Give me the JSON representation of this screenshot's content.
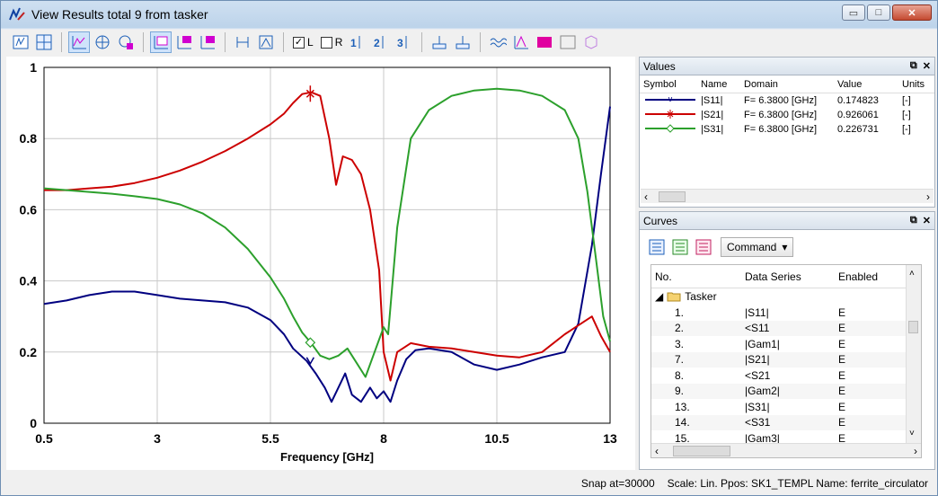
{
  "window": {
    "title": "View Results total 9 from tasker",
    "controls": {
      "minimize": "▭",
      "maximize": "□",
      "close": "✕"
    }
  },
  "toolbar": {
    "checkbox_l": {
      "label": "L",
      "checked": true
    },
    "checkbox_r": {
      "label": "R",
      "checked": false
    }
  },
  "chart_data": {
    "type": "line",
    "xlabel": "Frequency [GHz]",
    "ylabel": "",
    "xlim": [
      0.5,
      13
    ],
    "ylim": [
      0,
      1
    ],
    "xticks": [
      "0.5",
      "3",
      "5.5",
      "8",
      "10.5",
      "13"
    ],
    "yticks": [
      "0",
      "0.2",
      "0.4",
      "0.6",
      "0.8",
      "1"
    ],
    "grid": true,
    "series": [
      {
        "name": "|S11|",
        "color": "#000080",
        "x": [
          0.5,
          1.0,
          1.5,
          2.0,
          2.5,
          3.0,
          3.5,
          4.0,
          4.5,
          5.0,
          5.5,
          5.8,
          6.0,
          6.3,
          6.5,
          6.7,
          6.85,
          7.0,
          7.15,
          7.3,
          7.5,
          7.7,
          7.85,
          8.0,
          8.15,
          8.3,
          8.5,
          8.7,
          9.0,
          9.5,
          10.0,
          10.5,
          11.0,
          11.5,
          12.0,
          12.3,
          12.6,
          12.8,
          13.0
        ],
        "y": [
          0.335,
          0.345,
          0.36,
          0.37,
          0.37,
          0.36,
          0.35,
          0.345,
          0.34,
          0.325,
          0.29,
          0.25,
          0.21,
          0.175,
          0.14,
          0.1,
          0.06,
          0.1,
          0.14,
          0.08,
          0.06,
          0.1,
          0.07,
          0.09,
          0.06,
          0.12,
          0.18,
          0.205,
          0.21,
          0.2,
          0.165,
          0.15,
          0.165,
          0.185,
          0.2,
          0.28,
          0.5,
          0.7,
          0.89
        ]
      },
      {
        "name": "|S21|",
        "color": "#cc0000",
        "x": [
          0.5,
          1.0,
          1.5,
          2.0,
          2.5,
          3.0,
          3.5,
          4.0,
          4.5,
          5.0,
          5.5,
          5.8,
          6.0,
          6.2,
          6.4,
          6.6,
          6.8,
          6.95,
          7.1,
          7.3,
          7.5,
          7.7,
          7.9,
          8.0,
          8.15,
          8.3,
          8.6,
          9.0,
          9.5,
          10.0,
          10.5,
          11.0,
          11.5,
          12.0,
          12.3,
          12.6,
          12.8,
          13.0
        ],
        "y": [
          0.655,
          0.655,
          0.66,
          0.665,
          0.675,
          0.69,
          0.71,
          0.735,
          0.765,
          0.8,
          0.84,
          0.87,
          0.9,
          0.925,
          0.93,
          0.92,
          0.8,
          0.67,
          0.75,
          0.74,
          0.7,
          0.6,
          0.43,
          0.2,
          0.12,
          0.2,
          0.225,
          0.215,
          0.21,
          0.2,
          0.19,
          0.185,
          0.2,
          0.25,
          0.275,
          0.3,
          0.245,
          0.2
        ]
      },
      {
        "name": "|S31|",
        "color": "#2ca02c",
        "x": [
          0.5,
          1.0,
          1.5,
          2.0,
          2.5,
          3.0,
          3.5,
          4.0,
          4.5,
          5.0,
          5.5,
          5.8,
          6.0,
          6.2,
          6.4,
          6.6,
          6.8,
          7.0,
          7.2,
          7.4,
          7.6,
          7.8,
          8.0,
          8.1,
          8.3,
          8.6,
          9.0,
          9.5,
          10.0,
          10.5,
          11.0,
          11.5,
          12.0,
          12.3,
          12.5,
          12.7,
          12.85,
          13.0
        ],
        "y": [
          0.66,
          0.655,
          0.65,
          0.645,
          0.638,
          0.63,
          0.615,
          0.59,
          0.55,
          0.49,
          0.41,
          0.35,
          0.3,
          0.255,
          0.225,
          0.19,
          0.18,
          0.19,
          0.21,
          0.17,
          0.13,
          0.2,
          0.27,
          0.25,
          0.55,
          0.8,
          0.88,
          0.92,
          0.935,
          0.94,
          0.935,
          0.92,
          0.88,
          0.8,
          0.65,
          0.45,
          0.3,
          0.23
        ]
      }
    ]
  },
  "values_panel": {
    "title": "Values",
    "columns": [
      "Symbol",
      "Name",
      "Domain",
      "Value",
      "Units"
    ],
    "rows": [
      {
        "name": "|S11|",
        "domain": "F=  6.3800 [GHz]",
        "value": "0.174823",
        "units": "[-]",
        "color": "#000080",
        "marker": "v"
      },
      {
        "name": "|S21|",
        "domain": "F=  6.3800 [GHz]",
        "value": "0.926061",
        "units": "[-]",
        "color": "#cc0000",
        "marker": "x"
      },
      {
        "name": "|S31|",
        "domain": "F=  6.3800 [GHz]",
        "value": "0.226731",
        "units": "[-]",
        "color": "#2ca02c",
        "marker": "diamond"
      }
    ]
  },
  "curves_panel": {
    "title": "Curves",
    "command_label": "Command",
    "columns": [
      "No.",
      "Data Series",
      "Enabled"
    ],
    "group": "Tasker",
    "rows": [
      {
        "no": "1.",
        "series": "|S11|",
        "enabled": "E"
      },
      {
        "no": "2.",
        "series": "<S11",
        "enabled": "E"
      },
      {
        "no": "3.",
        "series": "|Gam1|",
        "enabled": "E"
      },
      {
        "no": "7.",
        "series": "|S21|",
        "enabled": "E"
      },
      {
        "no": "8.",
        "series": "<S21",
        "enabled": "E"
      },
      {
        "no": "9.",
        "series": "|Gam2|",
        "enabled": "E"
      },
      {
        "no": "13.",
        "series": "|S31|",
        "enabled": "E"
      },
      {
        "no": "14.",
        "series": "<S31",
        "enabled": "E"
      },
      {
        "no": "15.",
        "series": "|Gam3|",
        "enabled": "E"
      }
    ]
  },
  "status": {
    "snap": "Snap at=30000",
    "info": "Scale: Lin.  Ppos: SK1_TEMPL  Name: ferrite_circulator"
  }
}
